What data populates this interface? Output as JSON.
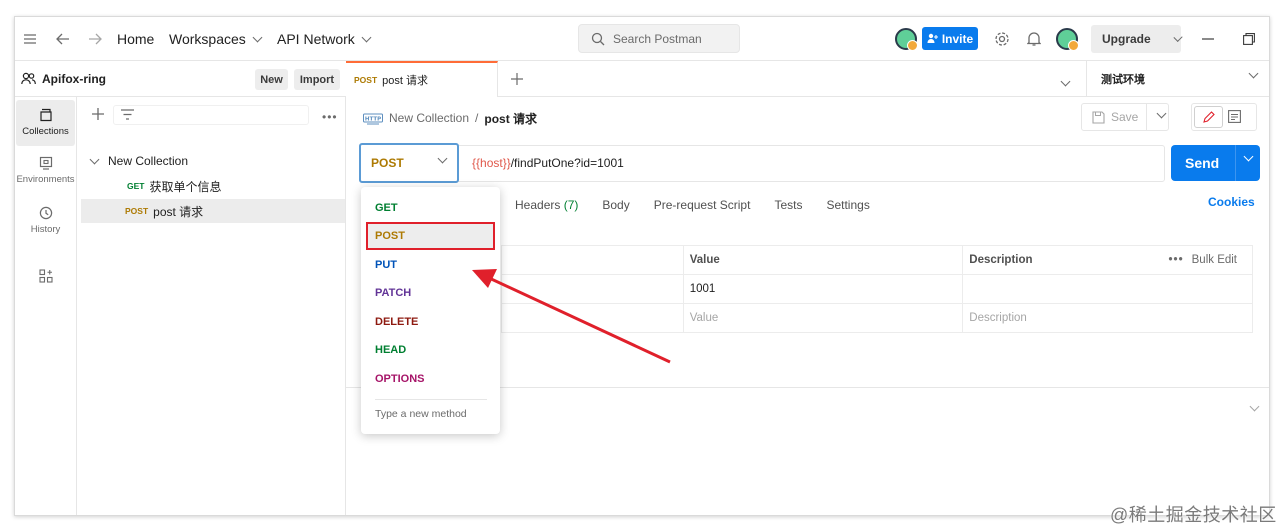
{
  "topbar": {
    "home": "Home",
    "workspaces": "Workspaces",
    "api_network": "API Network",
    "search_placeholder": "Search Postman",
    "invite": "Invite",
    "upgrade": "Upgrade"
  },
  "workspace": {
    "name": "Apifox-ring",
    "new_label": "New",
    "import_label": "Import"
  },
  "sidebar": {
    "items": [
      {
        "label": "Collections",
        "icon": "collections-icon",
        "active": true
      },
      {
        "label": "Environments",
        "icon": "environments-icon"
      },
      {
        "label": "History",
        "icon": "history-icon"
      },
      {
        "label": "",
        "icon": "apps-icon"
      }
    ]
  },
  "collections": {
    "tree": [
      {
        "label": "New Collection",
        "type": "folder"
      },
      {
        "method": "GET",
        "label": "获取单个信息"
      },
      {
        "method": "POST",
        "label": "post 请求",
        "selected": true
      }
    ]
  },
  "tabs": {
    "active": {
      "method": "POST",
      "label": "post 请求"
    },
    "environment": "测试环境"
  },
  "request": {
    "breadcrumb_parent": "New Collection",
    "breadcrumb_sep": "/",
    "breadcrumb_current": "post 请求",
    "save_label": "Save",
    "method": "POST",
    "url_var": "{{host}}",
    "url_path": "/findPutOne?id=1001",
    "send_label": "Send",
    "tabs": [
      {
        "label": "Headers",
        "count": "(7)"
      },
      {
        "label": "Body"
      },
      {
        "label": "Pre-request Script"
      },
      {
        "label": "Tests"
      },
      {
        "label": "Settings"
      }
    ],
    "cookies_label": "Cookies"
  },
  "params": {
    "headers": {
      "value": "Value",
      "description": "Description",
      "bulk_edit": "Bulk Edit"
    },
    "rows": [
      {
        "value": "1001",
        "description": ""
      }
    ],
    "placeholder_row": {
      "value": "Value",
      "description": "Description"
    }
  },
  "method_dropdown": {
    "options": [
      {
        "label": "GET",
        "color": "#007f31"
      },
      {
        "label": "POST",
        "color": "#ad7a03",
        "selected": true
      },
      {
        "label": "PUT",
        "color": "#0053b8"
      },
      {
        "label": "PATCH",
        "color": "#623497"
      },
      {
        "label": "DELETE",
        "color": "#8e1a10"
      },
      {
        "label": "HEAD",
        "color": "#007f31"
      },
      {
        "label": "OPTIONS",
        "color": "#a61468"
      }
    ],
    "new_method_placeholder": "Type a new method"
  },
  "watermark": "@稀土掘金技术社区",
  "colors": {
    "accent": "#097bed",
    "active_tab": "#ff6c37",
    "highlight": "#e0202b"
  }
}
